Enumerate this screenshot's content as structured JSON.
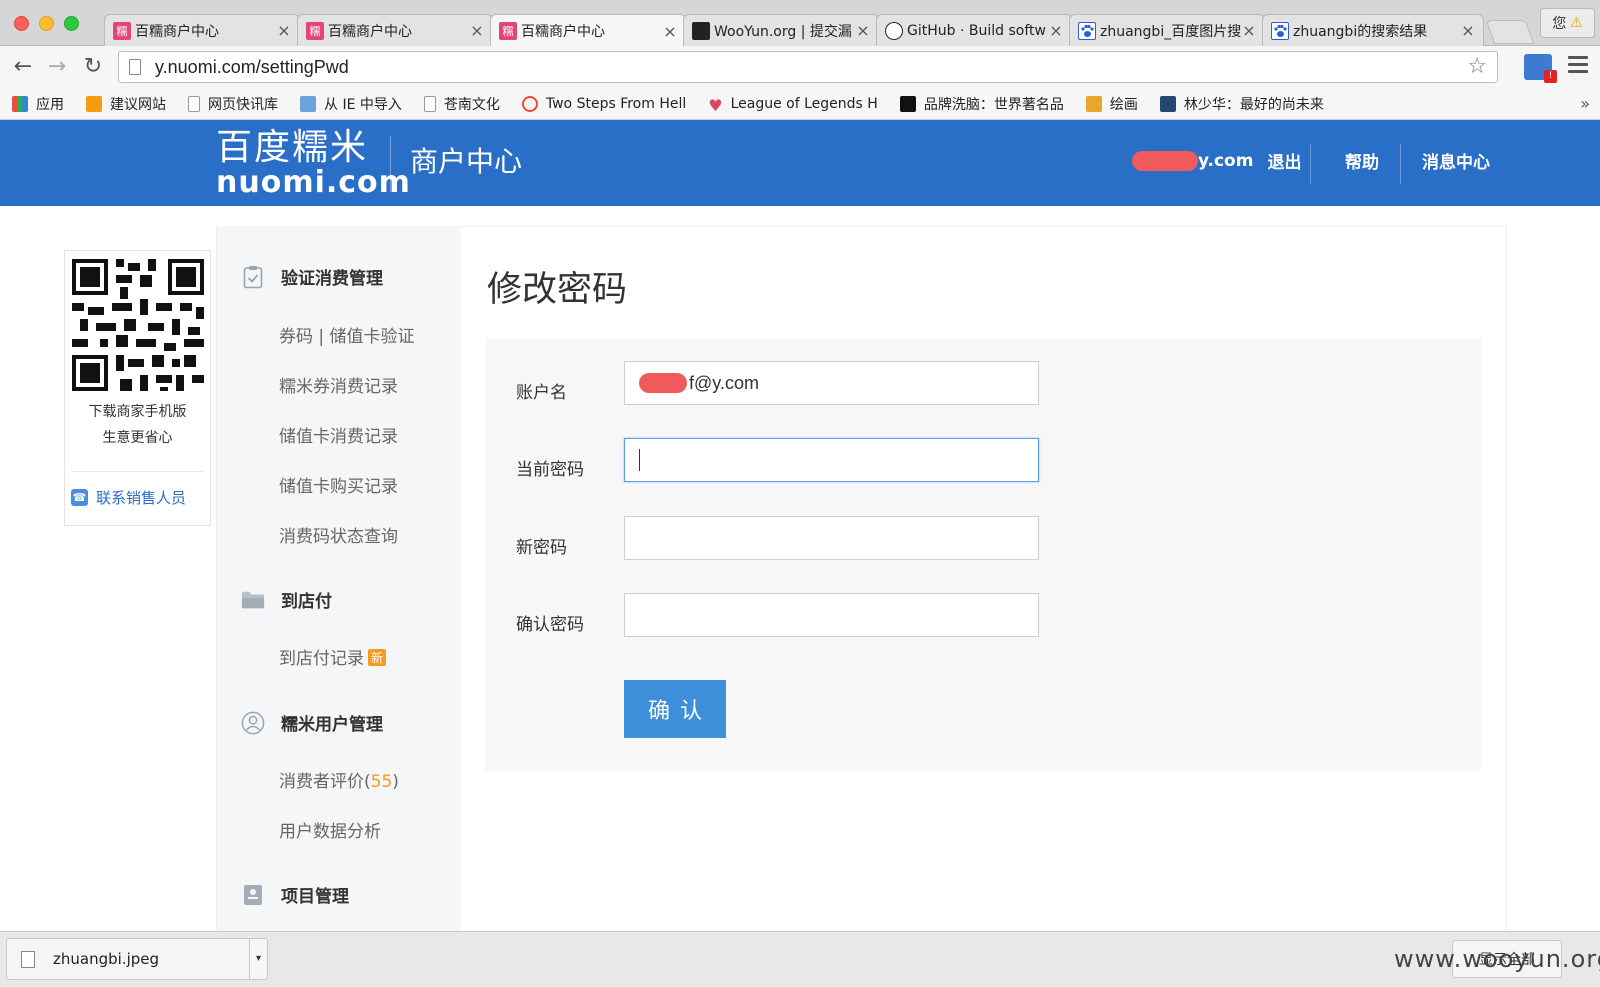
{
  "browser": {
    "tabs": [
      {
        "title": "百糯商户中心",
        "favicon": "nuomi-icon",
        "active": false
      },
      {
        "title": "百糯商户中心",
        "favicon": "nuomi-icon",
        "active": false
      },
      {
        "title": "百糯商户中心",
        "favicon": "nuomi-icon",
        "active": true
      },
      {
        "title": "WooYun.org | 提交漏",
        "favicon": "wooyun-icon",
        "active": false
      },
      {
        "title": "GitHub · Build softw",
        "favicon": "github-icon",
        "active": false
      },
      {
        "title": "zhuangbi_百度图片搜",
        "favicon": "baidu-paw-icon",
        "active": false
      },
      {
        "title": "zhuangbi的搜索结果",
        "favicon": "baidu-paw-icon",
        "active": false
      }
    ],
    "tab_close": "×",
    "profile_label": "您",
    "url": "y.nuomi.com/settingPwd",
    "bookmarks": [
      {
        "label": "应用",
        "icon": "apps-grid-icon"
      },
      {
        "label": "建议网站",
        "icon": "lightbulb-icon"
      },
      {
        "label": "网页快讯库",
        "icon": "page-icon"
      },
      {
        "label": "从 IE 中导入",
        "icon": "folder-icon"
      },
      {
        "label": "苍南文化",
        "icon": "page-icon"
      },
      {
        "label": "Two Steps From Hell",
        "icon": "ring-icon"
      },
      {
        "label": "League of Legends H",
        "icon": "heart-icon"
      },
      {
        "label": "品牌洗脑：世界著名品",
        "icon": "bird-icon"
      },
      {
        "label": "绘画",
        "icon": "paint-icon"
      },
      {
        "label": "林少华：最好的尚未来",
        "icon": "site-icon"
      }
    ],
    "bookmarks_more": "»"
  },
  "header": {
    "logo_cn": "百度糯米",
    "logo_en": "nuomi.com",
    "subtitle": "商户中心",
    "user_suffix": "y.com",
    "logout": "退出",
    "help": "帮助",
    "messages": "消息中心"
  },
  "qr_card": {
    "line1": "下载商家手机版",
    "line2": "生意更省心",
    "contact": "联系销售人员"
  },
  "sidebar": {
    "groups": [
      {
        "title": "验证消费管理",
        "icon": "clipboard-check-icon",
        "items": [
          "券码 | 储值卡验证",
          "糯米券消费记录",
          "储值卡消费记录",
          "储值卡购买记录",
          "消费码状态查询"
        ]
      },
      {
        "title": "到店付",
        "icon": "folder-icon",
        "items": [
          "到店付记录"
        ]
      },
      {
        "title": "糯米用户管理",
        "icon": "user-circle-icon",
        "items": [
          "消费者评价",
          "用户数据分析"
        ]
      },
      {
        "title": "项目管理",
        "icon": "document-icon",
        "items": []
      }
    ],
    "new_badge": "新",
    "review_count": "55",
    "paren_open": "(",
    "paren_close": ")"
  },
  "form": {
    "title": "修改密码",
    "account_label": "账户名",
    "account_value_suffix": "f@y.com",
    "current_pwd_label": "当前密码",
    "new_pwd_label": "新密码",
    "confirm_pwd_label": "确认密码",
    "submit_label": "确认"
  },
  "downloads": {
    "file_name": "zhuangbi.jpeg",
    "show_all": "显示全部"
  },
  "watermark": "www.wooyun.org"
}
